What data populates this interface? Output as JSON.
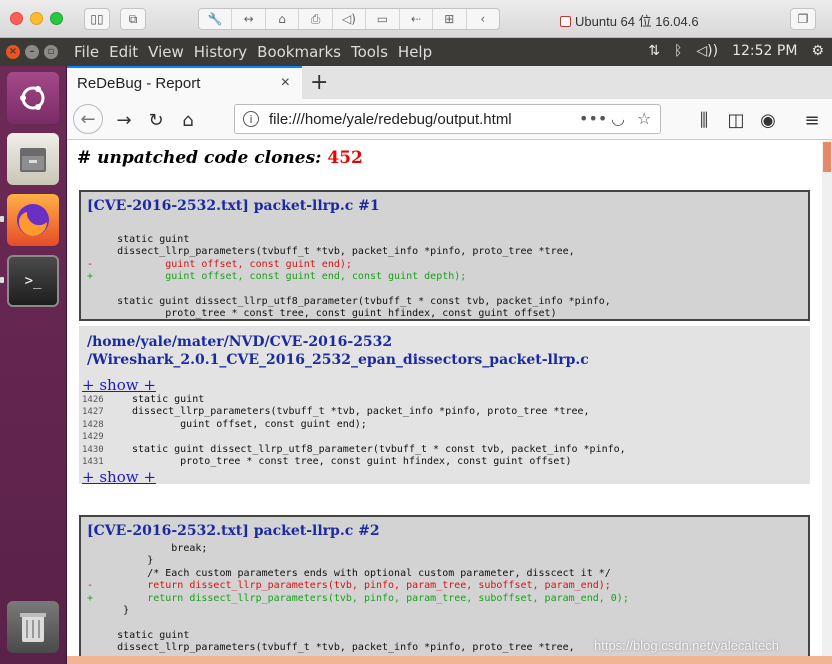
{
  "mac_window": {
    "title": "Ubuntu 64 位 16.04.6"
  },
  "ubuntu_panel": {
    "menu": [
      "File",
      "Edit",
      "View",
      "History",
      "Bookmarks",
      "Tools",
      "Help"
    ],
    "clock": "12:52 PM"
  },
  "firefox": {
    "tab_title": "ReDeBug - Report",
    "url": "file:///home/yale/redebug/output.html"
  },
  "report": {
    "heading_label": "# unpatched code clones:",
    "heading_count": "452",
    "card1": {
      "title": "[CVE-2016-2532.txt] packet-llrp.c #1",
      "lines": [
        {
          "t": "ctx",
          "text": "     static guint"
        },
        {
          "t": "ctx",
          "text": "     dissect_llrp_parameters(tvbuff_t *tvb, packet_info *pinfo, proto_tree *tree,"
        },
        {
          "t": "del",
          "text": "-            guint offset, const guint end);"
        },
        {
          "t": "add",
          "text": "+            guint offset, const guint end, const guint depth);"
        },
        {
          "t": "ctx",
          "text": ""
        },
        {
          "t": "ctx",
          "text": "     static guint dissect_llrp_utf8_parameter(tvbuff_t * const tvb, packet_info *pinfo,"
        },
        {
          "t": "ctx",
          "text": "             proto_tree * const tree, const guint hfindex, const guint offset)"
        }
      ]
    },
    "match1": {
      "path_line1": "/home/yale/mater/NVD/CVE-2016-2532",
      "path_line2": "/Wireshark_2.0.1_CVE_2016_2532_epan_dissectors_packet-llrp.c",
      "show_label": "+ show +",
      "linenos": [
        "1426",
        "1427",
        "1428",
        "1429",
        "1430",
        "1431"
      ],
      "code": [
        "static guint",
        "dissect_llrp_parameters(tvbuff_t *tvb, packet_info *pinfo, proto_tree *tree,",
        "        guint offset, const guint end);",
        "",
        "static guint dissect_llrp_utf8_parameter(tvbuff_t * const tvb, packet_info *pinfo,",
        "        proto_tree * const tree, const guint hfindex, const guint offset)"
      ]
    },
    "card2": {
      "title": "[CVE-2016-2532.txt] packet-llrp.c #2",
      "lines": [
        {
          "t": "ctx",
          "text": "              break;"
        },
        {
          "t": "ctx",
          "text": "          }"
        },
        {
          "t": "ctx",
          "text": "          /* Each custom parameters ends with optional custom parameter, disscect it */"
        },
        {
          "t": "del",
          "text": "-         return dissect_llrp_parameters(tvb, pinfo, param_tree, suboffset, param_end);"
        },
        {
          "t": "add",
          "text": "+         return dissect_llrp_parameters(tvb, pinfo, param_tree, suboffset, param_end, 0);"
        },
        {
          "t": "ctx",
          "text": "      }"
        },
        {
          "t": "ctx",
          "text": ""
        },
        {
          "t": "ctx",
          "text": "     static guint"
        },
        {
          "t": "ctx",
          "text": "     dissect_llrp_parameters(tvbuff_t *tvb, packet_info *pinfo, proto_tree *tree,"
        }
      ]
    }
  },
  "watermark": "https://blog.csdn.net/yalecaltech"
}
